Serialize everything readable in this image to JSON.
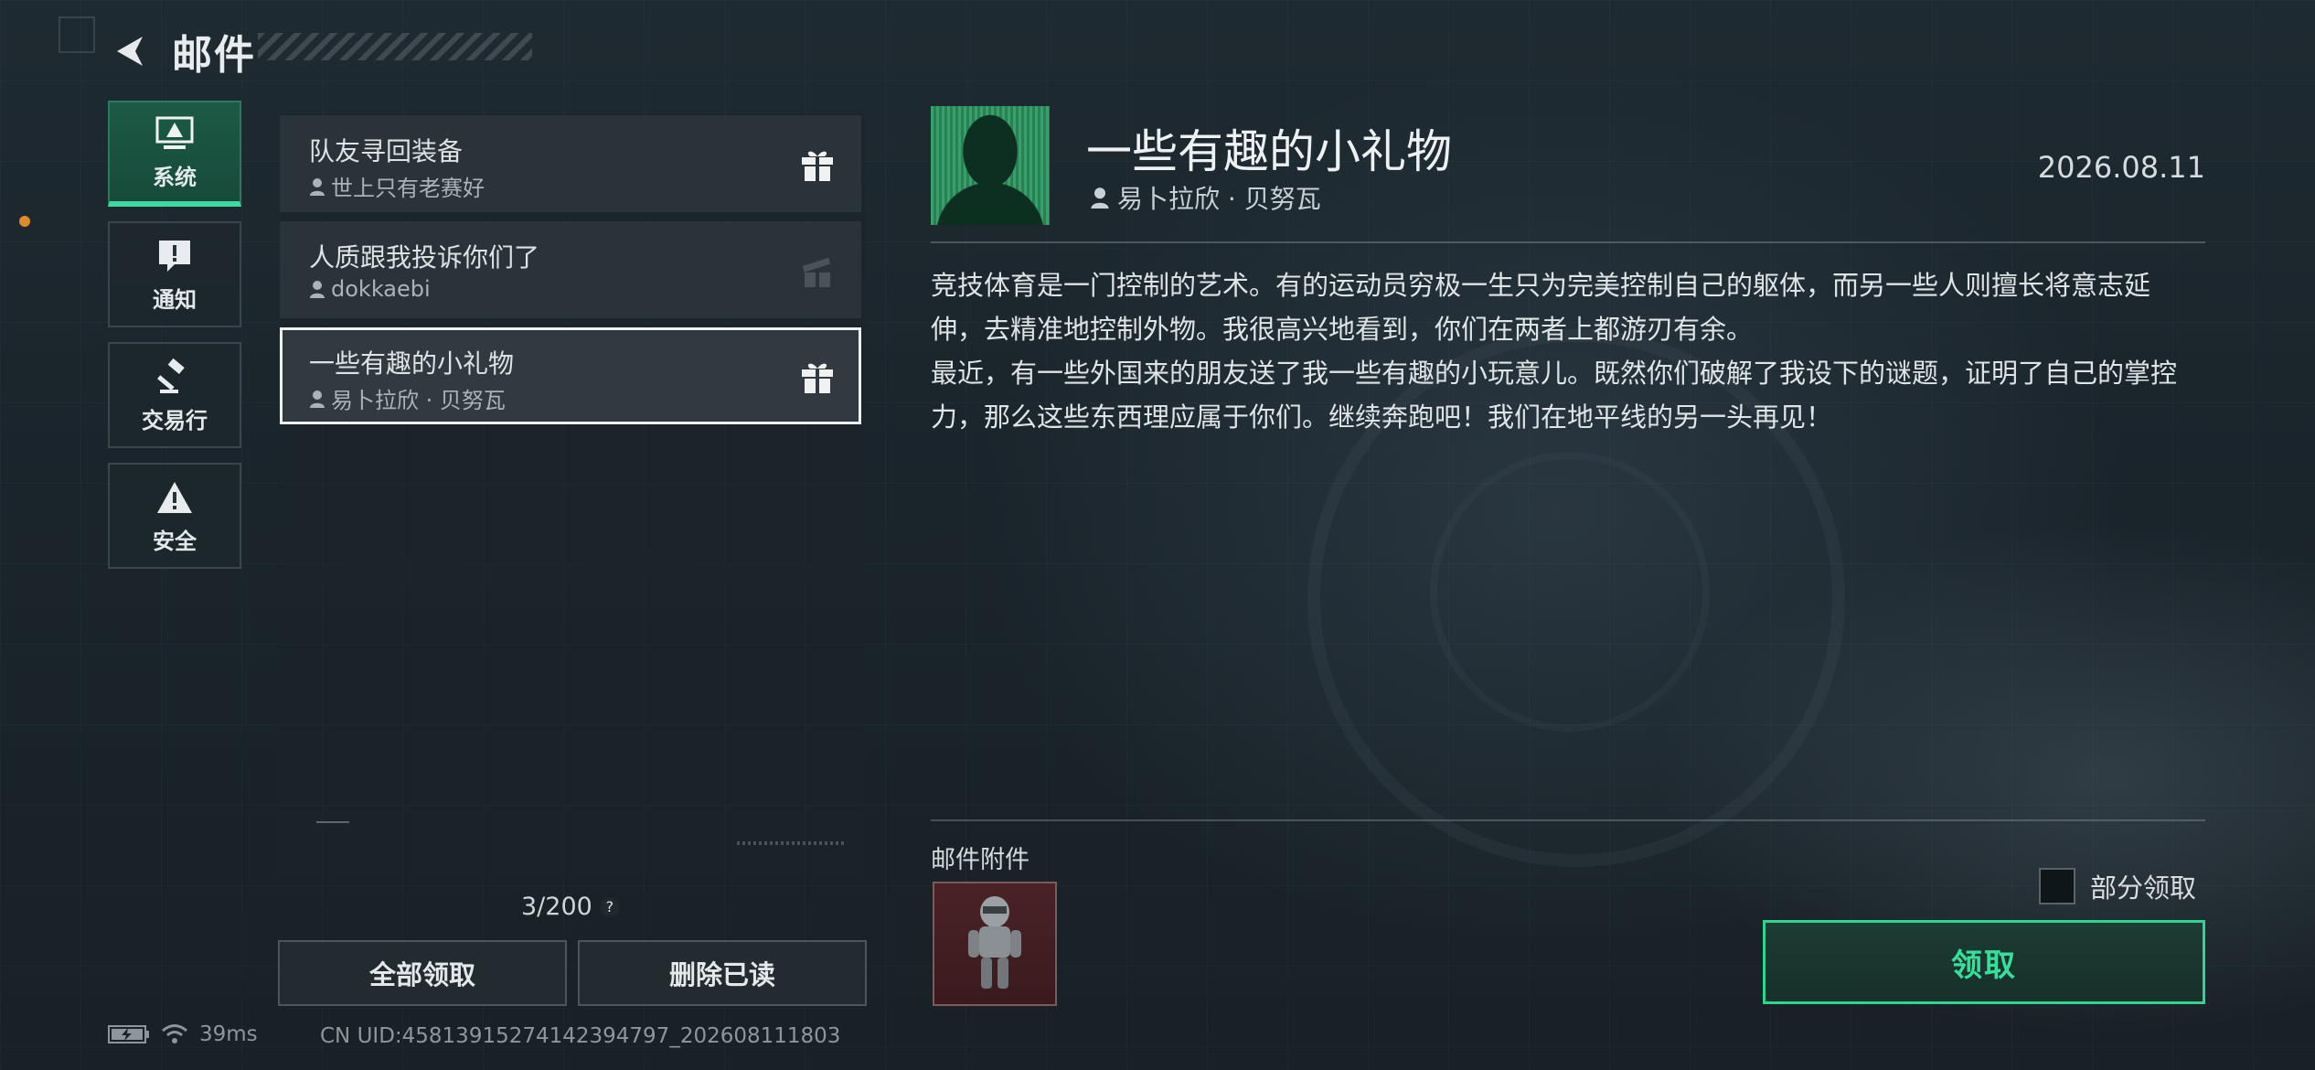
{
  "header": {
    "title": "邮件"
  },
  "categories": [
    {
      "label": "系统",
      "icon": "monitor-alert-icon",
      "active": true
    },
    {
      "label": "通知",
      "icon": "speech-bubble-exclamation-icon",
      "active": false
    },
    {
      "label": "交易行",
      "icon": "gavel-icon",
      "active": false
    },
    {
      "label": "安全",
      "icon": "warning-triangle-icon",
      "active": false
    }
  ],
  "mails": [
    {
      "subject": "队友寻回装备",
      "sender": "世上只有老赛好",
      "has_gift": true,
      "gift_claimed": false
    },
    {
      "subject": "人质跟我投诉你们了",
      "sender": "dokkaebi",
      "has_gift": true,
      "gift_claimed": true
    },
    {
      "subject": "一些有趣的小礼物",
      "sender": "易卜拉欣 · 贝努瓦",
      "has_gift": true,
      "gift_claimed": false,
      "selected": true
    }
  ],
  "mail_count": "3/200",
  "buttons": {
    "claim_all": "全部领取",
    "delete_read": "删除已读"
  },
  "status": {
    "latency": "39ms",
    "uid": "CN UID:4581391527414239479​7_202608111803"
  },
  "detail": {
    "title": "一些有趣的小礼物",
    "sender": "易卜拉欣 · 贝努瓦",
    "date": "2026.08.11",
    "paragraph1": "竞技体育是一门控制的艺术。有的运动员穷极一生只为完美控制自己的躯体，而另一些人则擅长将意志延伸，去精准地控制外物。我很高兴地看到，你们在两者上都游刃有余。",
    "paragraph2": "最近，有一些外国来的朋友送了我一些有趣的小玩意儿。既然你们破解了我设下的谜题，证明了自己的掌控力，那么这些东西理应属于你们。继续奔跑吧！我们在地平线的另一头再见！",
    "attachments_label": "邮件附件",
    "partial_claim_label": "部分领取",
    "claim_label": "领取"
  },
  "colors": {
    "accent_green": "#36e09c",
    "active_tab": "#1c5a45",
    "notification_dot": "#e08a2a"
  }
}
